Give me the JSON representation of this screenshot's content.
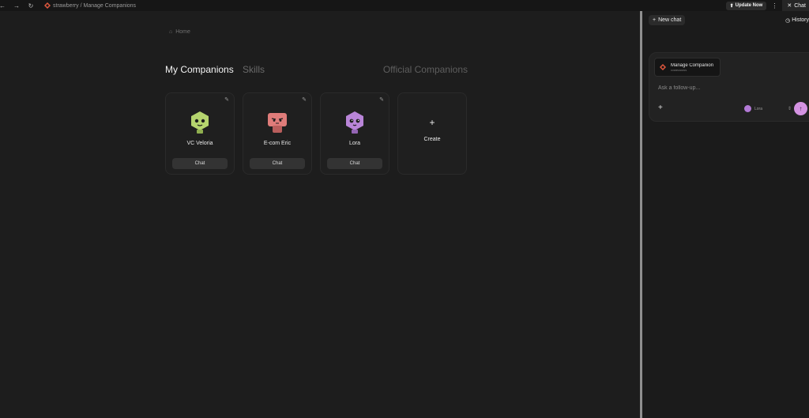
{
  "topbar": {
    "back_icon": "arrow-left-icon",
    "forward_icon": "arrow-right-icon",
    "reload_icon": "reload-icon",
    "brand_icon": "strawberry-logo-icon",
    "breadcrumb": "strawberry / Manage Companions",
    "update_label": "Update Now",
    "more_icon": "kebab-icon",
    "chat_tab_label": "Chat"
  },
  "main": {
    "home_label": "Home",
    "tabs": {
      "my_companions": "My Companions",
      "skills": "Skills",
      "official": "Official Companions"
    },
    "companions": [
      {
        "name": "VC Veloria",
        "chat_label": "Chat",
        "color": "#b5d46e"
      },
      {
        "name": "E-com Eric",
        "chat_label": "Chat",
        "color": "#df7c7a"
      },
      {
        "name": "Lora",
        "chat_label": "Chat",
        "color": "#b985d8"
      }
    ],
    "create_symbol": "+",
    "create_label": "Create"
  },
  "panel": {
    "new_chat_label": "New chat",
    "history_label": "History",
    "context_title": "Manage Companion",
    "context_sub": "COMPANIONS",
    "input_placeholder": "Ask a follow-up...",
    "attach_symbol": "+",
    "selected_companion": "Lora",
    "send_icon": "arrow-up-icon"
  },
  "colors": {
    "accent_send": "#d493e2",
    "brand": "#e2583e",
    "background": "#1b1b1b"
  }
}
